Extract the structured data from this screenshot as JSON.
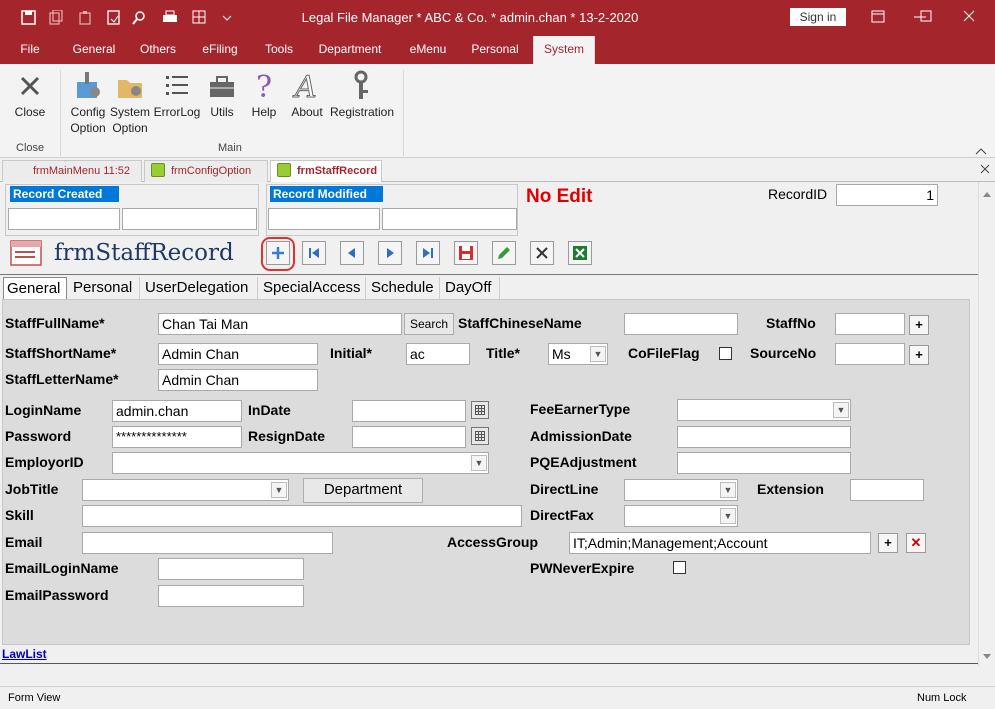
{
  "titlebar": {
    "title": "Legal File Manager * ABC & Co. * admin.chan * 13-2-2020",
    "sign_in": "Sign in",
    "icons": [
      "save-icon",
      "copy-icon",
      "paste-icon",
      "export-icon",
      "search-icon",
      "print-icon",
      "grid-icon",
      "dropdown-icon"
    ]
  },
  "ribbon_tabs": [
    "File",
    "General",
    "Others",
    "eFiling",
    "Tools",
    "Department",
    "eMenu",
    "Personal",
    "System"
  ],
  "ribbon": {
    "close_label": "Close",
    "close_group": "Close",
    "main_group": "Main",
    "buttons": [
      "Config Option",
      "System Option",
      "ErrorLog",
      "Utils",
      "Help",
      "About",
      "Registration"
    ]
  },
  "doc_tabs": [
    "frmMainMenu 11:52",
    "frmConfigOption",
    "frmStaffRecord"
  ],
  "form": {
    "record_created": "Record Created",
    "record_modified": "Record Modified",
    "no_edit": "No Edit",
    "record_id_label": "RecordID",
    "record_id": "1",
    "form_title": "frmStaffRecord",
    "tabs": [
      "General",
      "Personal",
      "UserDelegation",
      "SpecialAccess",
      "Schedule",
      "DayOff"
    ]
  },
  "fields": {
    "staff_full_name_label": "StaffFullName*",
    "staff_full_name": "Chan Tai Man",
    "search_btn": "Search",
    "staff_chinese_name_label": "StaffChineseName",
    "staff_no_label": "StaffNo",
    "staff_short_name_label": "StaffShortName*",
    "staff_short_name": "Admin Chan",
    "initial_label": "Initial*",
    "initial": "ac",
    "title_label": "Title*",
    "title": "Ms",
    "cofile_flag_label": "CoFileFlag",
    "source_no_label": "SourceNo",
    "staff_letter_name_label": "StaffLetterName*",
    "staff_letter_name": "Admin Chan",
    "login_name_label": "LoginName",
    "login_name": "admin.chan",
    "in_date_label": "InDate",
    "fee_earner_type_label": "FeeEarnerType",
    "password_label": "Password",
    "password": "**************",
    "resign_date_label": "ResignDate",
    "admission_date_label": "AdmissionDate",
    "employer_id_label": "EmployorID",
    "pqe_adjustment_label": "PQEAdjustment",
    "job_title_label": "JobTitle",
    "department_btn": "Department",
    "direct_line_label": "DirectLine",
    "extension_label": "Extension",
    "skill_label": "Skill",
    "direct_fax_label": "DirectFax",
    "email_label": "Email",
    "access_group_label": "AccessGroup",
    "access_group": "IT;Admin;Management;Account",
    "email_login_name_label": "EmailLoginName",
    "pw_never_expire_label": "PWNeverExpire",
    "email_password_label": "EmailPassword"
  },
  "lawlist": "LawList",
  "status": {
    "left": "Form View",
    "right": "Num Lock"
  }
}
